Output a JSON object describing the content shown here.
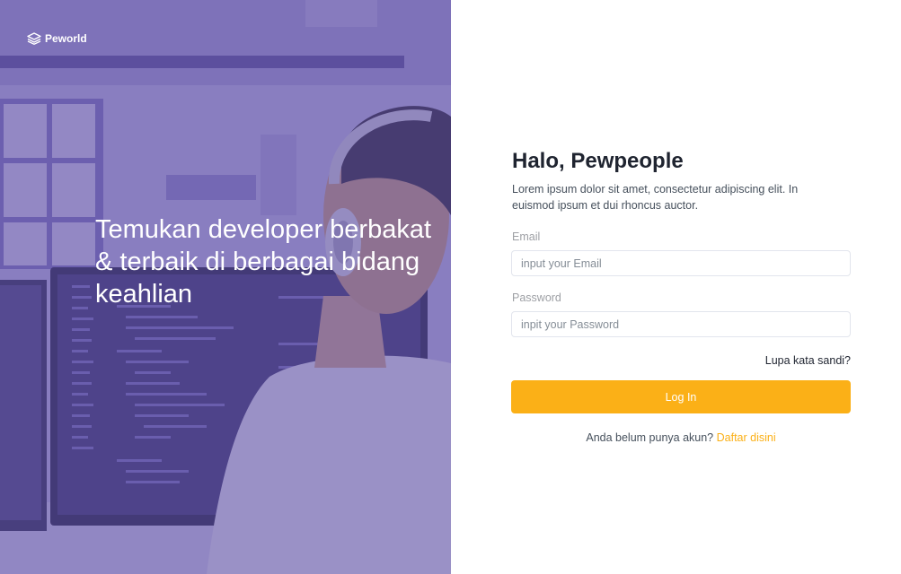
{
  "brand": {
    "name": "Peworld",
    "icon": "stacked-layers-logo-icon"
  },
  "hero": {
    "tagline": "Temukan developer berbakat & terbaik di berbagai bidang keahlian",
    "overlay_color": "#5e50a1"
  },
  "login": {
    "greeting": "Halo, Pewpeople",
    "description": "Lorem ipsum dolor sit amet, consectetur adipiscing elit. In euismod ipsum et dui rhoncus auctor.",
    "email_label": "Email",
    "email_placeholder": "input your Email",
    "password_label": "Password",
    "password_placeholder": "inpit your Password",
    "forgot_link": "Lupa kata sandi?",
    "submit_label": "Log In",
    "signup_prompt": "Anda belum punya akun?",
    "signup_link": "Daftar disini"
  },
  "colors": {
    "accent": "#fbb017",
    "primary": "#5e50a1"
  }
}
